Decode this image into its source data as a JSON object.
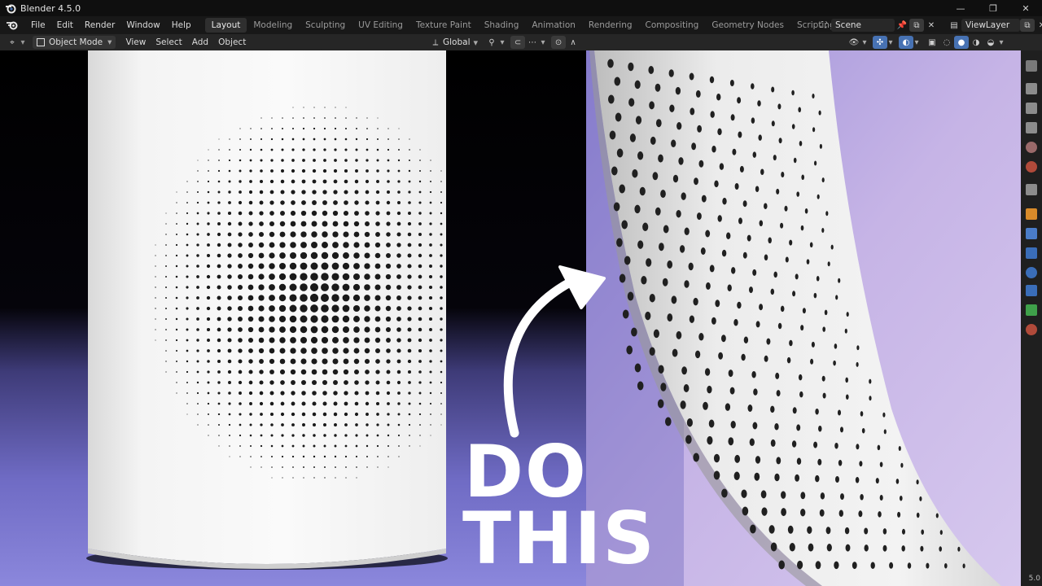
{
  "app": {
    "title": "Blender 4.5.0",
    "version_badge": "5.0"
  },
  "menu": {
    "items": [
      "File",
      "Edit",
      "Render",
      "Window",
      "Help"
    ]
  },
  "workspaces": {
    "tabs": [
      "Layout",
      "Modeling",
      "Sculpting",
      "UV Editing",
      "Texture Paint",
      "Shading",
      "Animation",
      "Rendering",
      "Compositing",
      "Geometry Nodes",
      "Scripting"
    ],
    "active": "Layout",
    "add": "+"
  },
  "scene": {
    "label": "Scene",
    "view_layer": "ViewLayer"
  },
  "header": {
    "mode": "Object Mode",
    "menus": [
      "View",
      "Select",
      "Add",
      "Object"
    ],
    "transform_orientation": "Global"
  },
  "overlay": {
    "line1": "DO",
    "line2": "THIS"
  },
  "colors": {
    "floor_purple": "#8a86d8",
    "wall_lavender": "#cbb8e6",
    "speaker_white": "#f2f2f2",
    "accent_blue": "#4772b3"
  },
  "icons": [
    "blender-logo-icon",
    "editor-type-icon",
    "object-mode-icon",
    "transform-orientation-icon",
    "snap-icon",
    "proportional-edit-icon",
    "visibility-icon",
    "gizmo-icon",
    "overlay-icon",
    "xray-icon",
    "wireframe-shading-icon",
    "solid-shading-icon",
    "material-shading-icon",
    "rendered-shading-icon",
    "tool-icon",
    "render-props-icon",
    "output-props-icon",
    "view-layer-props-icon",
    "scene-props-icon",
    "world-props-icon",
    "collection-props-icon",
    "object-props-icon",
    "modifier-props-icon",
    "particles-props-icon",
    "physics-props-icon",
    "constraints-props-icon",
    "data-props-icon",
    "material-props-icon"
  ]
}
